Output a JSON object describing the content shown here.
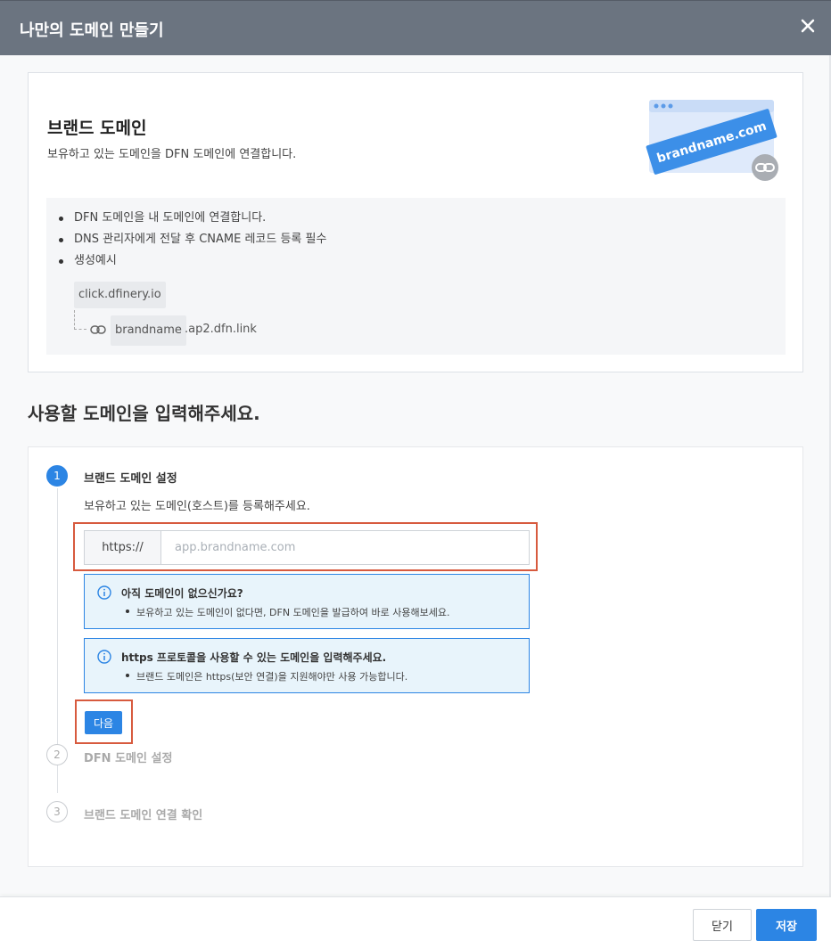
{
  "dialog": {
    "title": "나만의 도메인 만들기",
    "close_icon": "close-icon"
  },
  "brand": {
    "title": "브랜드 도메인",
    "description": "보유하고 있는 도메인을 DFN 도메인에 연결합니다.",
    "illustration_text": "brandname.com",
    "bullets": [
      "DFN 도메인을 내 도메인에 연결합니다.",
      "DNS 관리자에게 전달 후 CNAME 레코드 등록 필수",
      "생성예시"
    ],
    "example_domain": "click.dfinery.io",
    "example_brand": "brandname",
    "example_suffix": ".ap2.dfn.link"
  },
  "section_title": "사용할 도메인을 입력해주세요.",
  "steps": [
    {
      "number": "1",
      "label": "브랜드 도메인 설정",
      "state": "active"
    },
    {
      "number": "2",
      "label": "DFN 도메인 설정",
      "state": "inactive"
    },
    {
      "number": "3",
      "label": "브랜드 도메인 연결 확인",
      "state": "inactive"
    }
  ],
  "step1": {
    "description": "보유하고 있는 도메인(호스트)를 등록해주세요.",
    "input_prefix": "https://",
    "input_value": "",
    "input_placeholder": "app.brandname.com",
    "notices": [
      {
        "title": "아직 도메인이 없으신가요?",
        "text": "보유하고 있는 도메인이 없다면, DFN 도메인을 발급하여 바로 사용해보세요."
      },
      {
        "title": "https 프로토콜을 사용할 수 있는 도메인을 입력해주세요.",
        "text": "브랜드 도메인은 https(보안 연결)을 지원해야만 사용 가능합니다."
      }
    ],
    "next_label": "다음"
  },
  "footer": {
    "close_label": "닫기",
    "save_label": "저장"
  },
  "colors": {
    "titlebar": "#6b7480",
    "primary": "#2c85e4",
    "highlight": "#d75a3e",
    "notice_bg": "#e8f4fb"
  }
}
